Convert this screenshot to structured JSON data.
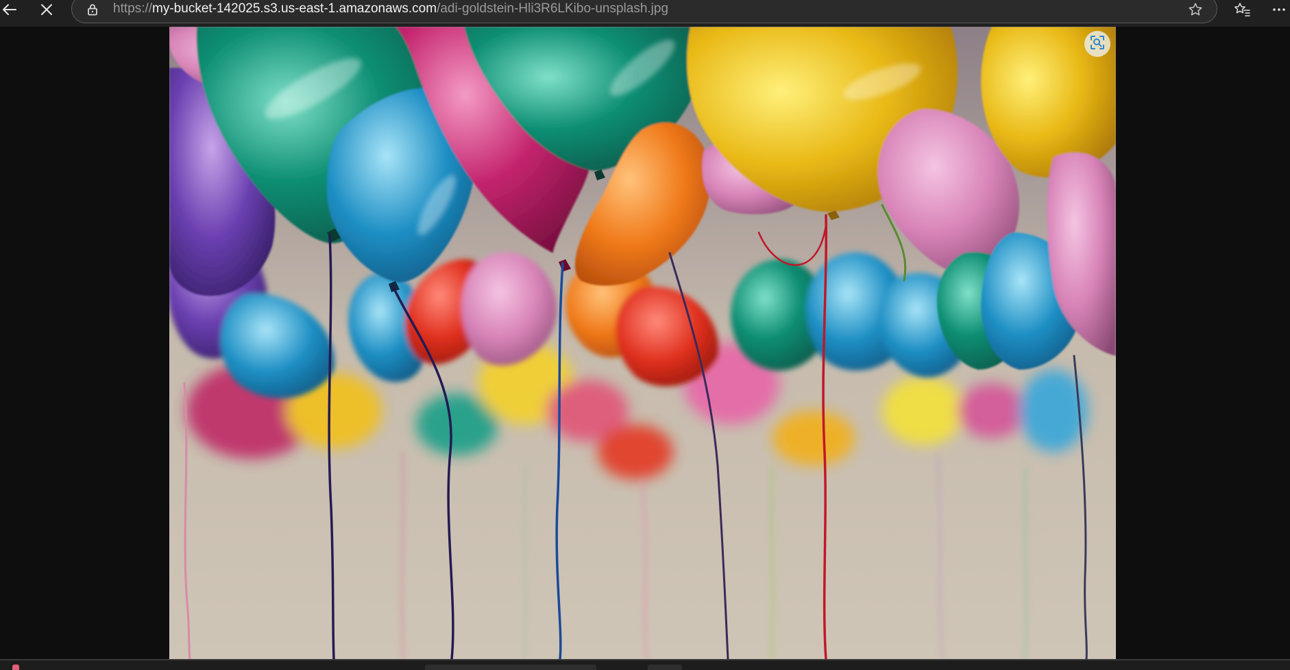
{
  "browser": {
    "url_scheme": "https://",
    "url_host": "my-bucket-142025.s3.us-east-1.amazonaws.com",
    "url_path": "/adi-goldstein-Hli3R6LKibo-unsplash.jpg",
    "icons": {
      "back": "back-arrow-icon",
      "stop": "close-icon",
      "lock": "lock-icon",
      "favorite": "star-icon",
      "favorites": "favorites-icon",
      "menu": "more-icon"
    }
  },
  "viewer": {
    "image_subject": "colorful helium balloons with ribbons",
    "visual_search_icon": "visual-search-icon"
  },
  "colors": {
    "toolbar_bg": "#202020",
    "page_bg": "#0e0e0e",
    "wall": "#c9c0b2"
  }
}
